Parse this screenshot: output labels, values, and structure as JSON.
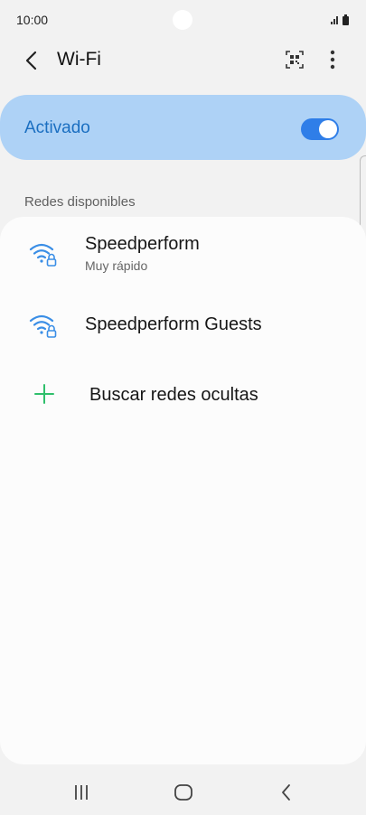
{
  "status_bar": {
    "time": "10:00",
    "icons": [
      "signal-icon",
      "battery-icon"
    ]
  },
  "header": {
    "title": "Wi-Fi",
    "icons": [
      "back-icon",
      "qr-code-icon",
      "more-options-icon"
    ]
  },
  "master_toggle": {
    "label": "Activado",
    "state": "on"
  },
  "section": {
    "header": "Redes disponibles"
  },
  "networks": [
    {
      "name": "Speedperform",
      "subtitle": "Muy rápido",
      "icon": "wifi-lock-icon"
    },
    {
      "name": "Speedperform Guests",
      "subtitle": "",
      "icon": "wifi-lock-icon"
    }
  ],
  "add_network": {
    "label": "Buscar redes ocultas",
    "icon": "plus-icon"
  },
  "nav": {
    "icons": [
      "recent-apps-icon",
      "home-icon",
      "back-nav-icon"
    ]
  },
  "colors": {
    "accent": "#2f7ee8",
    "toggle_bg": "#aed2f6",
    "toggle_text": "#1b6fc1",
    "add_icon": "#2fbf6b",
    "wifi_icon": "#3a8ee6"
  }
}
